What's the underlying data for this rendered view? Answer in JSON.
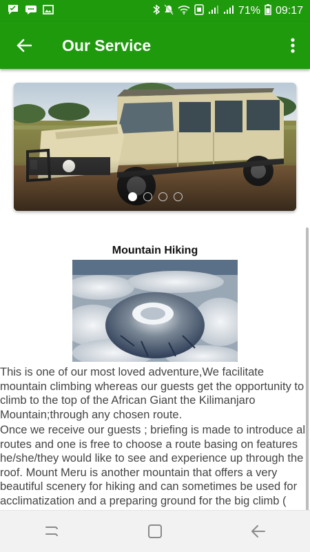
{
  "status_bar": {
    "battery": "71%",
    "time": "09:17",
    "icons": [
      "chat-icon",
      "message-icon",
      "image-icon",
      "bluetooth-icon",
      "mute-icon",
      "wifi-icon",
      "data-saver-icon",
      "signal-icon",
      "signal-icon",
      "battery-icon"
    ]
  },
  "app_bar": {
    "title": "Our Service",
    "back_icon": "arrow-back-icon",
    "menu_icon": "more-vert-icon"
  },
  "carousel": {
    "image": "safari-land-cruiser",
    "slide_count": 4,
    "active_slide": 1
  },
  "service": {
    "heading": "Mountain Hiking",
    "image": "kilimanjaro-aerial",
    "paragraph1": "This is one of our most loved adventure,We facilitate mountain climbing whereas our guests get the opportunity to climb to the top of the African Giant the Kilimanjaro Mountain;through any chosen route.",
    "paragraph2": "Once we receive our guests ; briefing is made to introduce all routes and one is free to choose a route basing on features he/she/they would like to see and experience up through the roof. Mount Meru is another mountain that offers a very beautiful scenery for hiking and can sometimes be used for acclimatization and a preparing ground for the big climb ( Mount Kilimanjaro )."
  },
  "nav_bar": {
    "icons": [
      "recent-apps-icon",
      "home-icon",
      "back-icon"
    ]
  },
  "colors": {
    "primary": "#1f9a0d",
    "text": "#444444",
    "nav_bg": "#f2f2f2"
  }
}
